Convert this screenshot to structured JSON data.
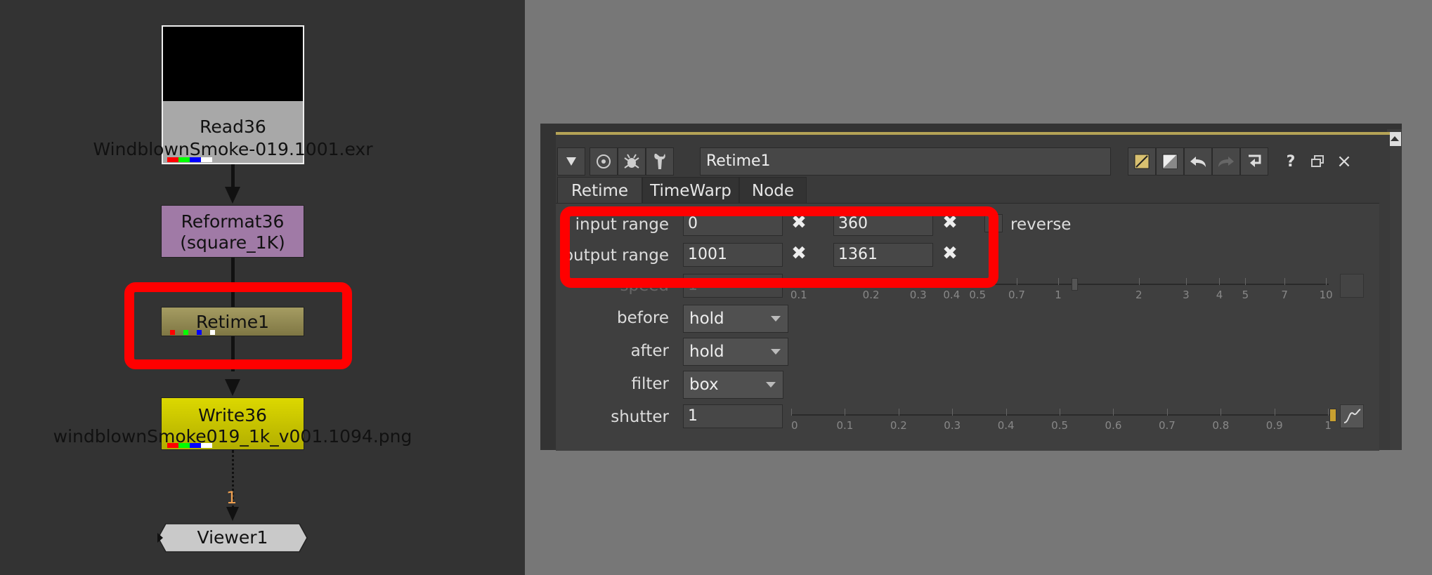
{
  "node_graph": {
    "read": {
      "title": "Read36",
      "file": "WindblownSmoke-019.1001.exr"
    },
    "reformat": {
      "title": "Reformat36",
      "subtitle": "(square_1K)"
    },
    "retime": {
      "title": "Retime1"
    },
    "write": {
      "title": "Write36",
      "file": "windblownSmoke019_1k_v001.1094.png"
    },
    "viewer": {
      "title": "Viewer1",
      "input_number": "1"
    }
  },
  "panel": {
    "node_name": "Retime1",
    "toolbar_icons": [
      "collapse-triangle-icon",
      "center-node-icon",
      "bug-icon",
      "wrench-icon",
      "node-color-icon",
      "node-color-alt-icon",
      "undo-icon",
      "redo-icon",
      "revert-icon",
      "help-icon",
      "float-icon",
      "close-icon"
    ],
    "help_glyph": "?",
    "close_glyph": "×",
    "tabs": [
      "Retime",
      "TimeWarp",
      "Node"
    ],
    "active_tab": "Retime",
    "fields": {
      "input_range_label": "input range",
      "input_first": "0",
      "input_last": "360",
      "reverse_label": "reverse",
      "output_range_label": "output range",
      "output_first": "1001",
      "output_last": "1361",
      "speed_label": "speed",
      "speed_value": "1",
      "before_label": "before",
      "before_value": "hold",
      "after_label": "after",
      "after_value": "hold",
      "filter_label": "filter",
      "filter_value": "box",
      "shutter_label": "shutter",
      "shutter_value": "1",
      "remove_glyph": "✖"
    },
    "speed_slider_ticks": [
      "0.1",
      "0.2",
      "0.3",
      "0.4",
      "0.5",
      "0.7",
      "1",
      "2",
      "3",
      "4",
      "5",
      "7",
      "10"
    ],
    "shutter_slider_ticks": [
      "0",
      "0.1",
      "0.2",
      "0.3",
      "0.4",
      "0.5",
      "0.6",
      "0.7",
      "0.8",
      "0.9",
      "1"
    ]
  },
  "colors": {
    "highlight": "#ff0000",
    "read_node": "#aaaaaa",
    "reformat_node": "#a07aa6",
    "retime_node": "#8f8752",
    "write_node": "#c7c400",
    "viewer_node": "#c4c4c4"
  }
}
